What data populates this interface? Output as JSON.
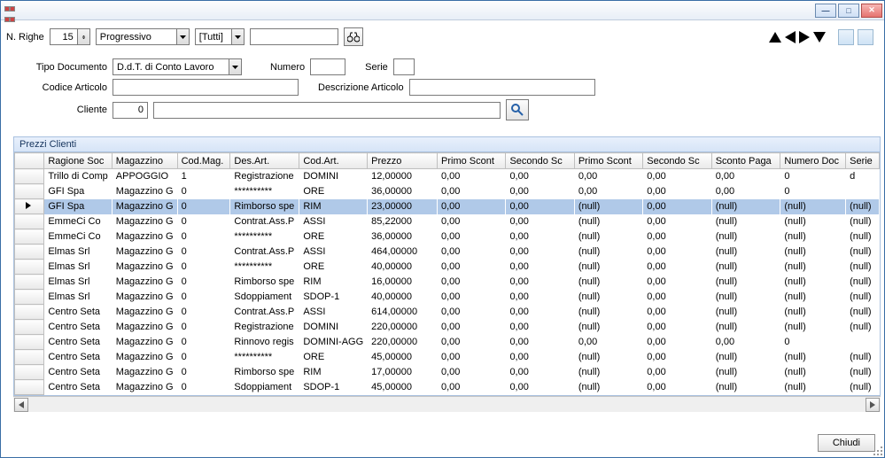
{
  "toolbar": {
    "nRigheLabel": "N. Righe",
    "nRigheValue": "15",
    "progressivo": "Progressivo",
    "tutti": "[Tutti]",
    "searchText": ""
  },
  "form": {
    "tipoDocLabel": "Tipo Documento",
    "tipoDocValue": "D.d.T. di Conto Lavoro",
    "numeroLabel": "Numero",
    "numeroValue": "",
    "serieLabel": "Serie",
    "serieValue": "",
    "codiceArtLabel": "Codice Articolo",
    "codiceArtValue": "",
    "descrArtLabel": "Descrizione Articolo",
    "descrArtValue": "",
    "clienteLabel": "Cliente",
    "clienteValue": "0",
    "clienteDesc": ""
  },
  "section": "Prezzi Clienti",
  "columns": [
    "",
    "Ragione Soc",
    "Magazzino",
    "Cod.Mag.",
    "Des.Art.",
    "Cod.Art.",
    "Prezzo",
    "Primo Scont",
    "Secondo Sc",
    "Primo Scont",
    "Secondo Sc",
    "Sconto Paga",
    "Numero Doc",
    "Serie"
  ],
  "rows": [
    {
      "sel": false,
      "ragione": "Trillo di Comp",
      "mag": "APPOGGIO",
      "codmag": "1",
      "desart": "Registrazione",
      "codart": "DOMINI",
      "prezzo": "12,00000",
      "ps1": "0,00",
      "ss1": "0,00",
      "ps2": "0,00",
      "ss2": "0,00",
      "sp": "0,00",
      "num": "0",
      "serie": "d"
    },
    {
      "sel": false,
      "ragione": "GFI Spa",
      "mag": "Magazzino G",
      "codmag": "0",
      "desart": "**********",
      "codart": "ORE",
      "prezzo": "36,00000",
      "ps1": "0,00",
      "ss1": "0,00",
      "ps2": "0,00",
      "ss2": "0,00",
      "sp": "0,00",
      "num": "0",
      "serie": ""
    },
    {
      "sel": true,
      "ragione": "GFI Spa",
      "mag": "Magazzino G",
      "codmag": "0",
      "desart": "Rimborso spe",
      "codart": "RIM",
      "prezzo": "23,00000",
      "ps1": "0,00",
      "ss1": "0,00",
      "ps2": "(null)",
      "ss2": "0,00",
      "sp": "(null)",
      "num": "(null)",
      "serie": "(null)"
    },
    {
      "sel": false,
      "ragione": "EmmeCi Co",
      "mag": "Magazzino G",
      "codmag": "0",
      "desart": "Contrat.Ass.P",
      "codart": "ASSI",
      "prezzo": "85,22000",
      "ps1": "0,00",
      "ss1": "0,00",
      "ps2": "(null)",
      "ss2": "0,00",
      "sp": "(null)",
      "num": "(null)",
      "serie": "(null)"
    },
    {
      "sel": false,
      "ragione": "EmmeCi Co",
      "mag": "Magazzino G",
      "codmag": "0",
      "desart": "**********",
      "codart": "ORE",
      "prezzo": "36,00000",
      "ps1": "0,00",
      "ss1": "0,00",
      "ps2": "(null)",
      "ss2": "0,00",
      "sp": "(null)",
      "num": "(null)",
      "serie": "(null)"
    },
    {
      "sel": false,
      "ragione": "Elmas Srl",
      "mag": "Magazzino G",
      "codmag": "0",
      "desart": "Contrat.Ass.P",
      "codart": "ASSI",
      "prezzo": "464,00000",
      "ps1": "0,00",
      "ss1": "0,00",
      "ps2": "(null)",
      "ss2": "0,00",
      "sp": "(null)",
      "num": "(null)",
      "serie": "(null)"
    },
    {
      "sel": false,
      "ragione": "Elmas Srl",
      "mag": "Magazzino G",
      "codmag": "0",
      "desart": "**********",
      "codart": "ORE",
      "prezzo": "40,00000",
      "ps1": "0,00",
      "ss1": "0,00",
      "ps2": "(null)",
      "ss2": "0,00",
      "sp": "(null)",
      "num": "(null)",
      "serie": "(null)"
    },
    {
      "sel": false,
      "ragione": "Elmas Srl",
      "mag": "Magazzino G",
      "codmag": "0",
      "desart": "Rimborso spe",
      "codart": "RIM",
      "prezzo": "16,00000",
      "ps1": "0,00",
      "ss1": "0,00",
      "ps2": "(null)",
      "ss2": "0,00",
      "sp": "(null)",
      "num": "(null)",
      "serie": "(null)"
    },
    {
      "sel": false,
      "ragione": "Elmas Srl",
      "mag": "Magazzino G",
      "codmag": "0",
      "desart": "Sdoppiament",
      "codart": "SDOP-1",
      "prezzo": "40,00000",
      "ps1": "0,00",
      "ss1": "0,00",
      "ps2": "(null)",
      "ss2": "0,00",
      "sp": "(null)",
      "num": "(null)",
      "serie": "(null)"
    },
    {
      "sel": false,
      "ragione": "Centro Seta",
      "mag": "Magazzino G",
      "codmag": "0",
      "desart": "Contrat.Ass.P",
      "codart": "ASSI",
      "prezzo": "614,00000",
      "ps1": "0,00",
      "ss1": "0,00",
      "ps2": "(null)",
      "ss2": "0,00",
      "sp": "(null)",
      "num": "(null)",
      "serie": "(null)"
    },
    {
      "sel": false,
      "ragione": "Centro Seta",
      "mag": "Magazzino G",
      "codmag": "0",
      "desart": "Registrazione",
      "codart": "DOMINI",
      "prezzo": "220,00000",
      "ps1": "0,00",
      "ss1": "0,00",
      "ps2": "(null)",
      "ss2": "0,00",
      "sp": "(null)",
      "num": "(null)",
      "serie": "(null)"
    },
    {
      "sel": false,
      "ragione": "Centro Seta",
      "mag": "Magazzino G",
      "codmag": "0",
      "desart": "Rinnovo regis",
      "codart": "DOMINI-AGG",
      "prezzo": "220,00000",
      "ps1": "0,00",
      "ss1": "0,00",
      "ps2": "0,00",
      "ss2": "0,00",
      "sp": "0,00",
      "num": "0",
      "serie": ""
    },
    {
      "sel": false,
      "ragione": "Centro Seta",
      "mag": "Magazzino G",
      "codmag": "0",
      "desart": "**********",
      "codart": "ORE",
      "prezzo": "45,00000",
      "ps1": "0,00",
      "ss1": "0,00",
      "ps2": "(null)",
      "ss2": "0,00",
      "sp": "(null)",
      "num": "(null)",
      "serie": "(null)"
    },
    {
      "sel": false,
      "ragione": "Centro Seta",
      "mag": "Magazzino G",
      "codmag": "0",
      "desart": "Rimborso spe",
      "codart": "RIM",
      "prezzo": "17,00000",
      "ps1": "0,00",
      "ss1": "0,00",
      "ps2": "(null)",
      "ss2": "0,00",
      "sp": "(null)",
      "num": "(null)",
      "serie": "(null)"
    },
    {
      "sel": false,
      "ragione": "Centro Seta",
      "mag": "Magazzino G",
      "codmag": "0",
      "desart": "Sdoppiament",
      "codart": "SDOP-1",
      "prezzo": "45,00000",
      "ps1": "0,00",
      "ss1": "0,00",
      "ps2": "(null)",
      "ss2": "0,00",
      "sp": "(null)",
      "num": "(null)",
      "serie": "(null)"
    }
  ],
  "footer": {
    "close": "Chiudi"
  }
}
